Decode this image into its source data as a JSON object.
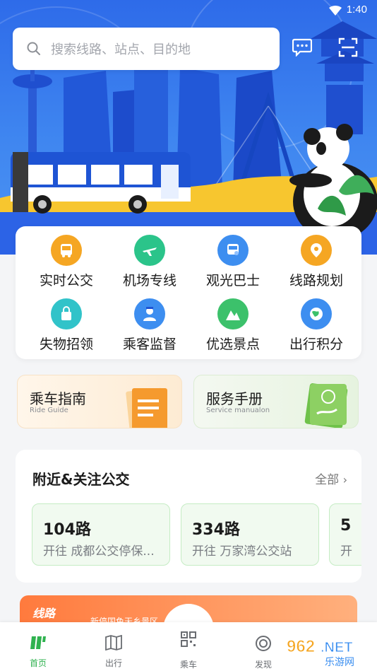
{
  "status_bar": {
    "time": "1:40"
  },
  "search": {
    "placeholder": "搜索线路、站点、目的地"
  },
  "services": [
    {
      "label": "实时公交",
      "icon": "realtime-bus-icon",
      "color": "#f5a623"
    },
    {
      "label": "机场专线",
      "icon": "airport-line-icon",
      "color": "#2bc48a"
    },
    {
      "label": "观光巴士",
      "icon": "sightseeing-bus-icon",
      "color": "#3d8ef0"
    },
    {
      "label": "线路规划",
      "icon": "route-planning-icon",
      "color": "#f5a623"
    },
    {
      "label": "失物招领",
      "icon": "lost-found-icon",
      "color": "#31c3c9"
    },
    {
      "label": "乘客监督",
      "icon": "passenger-supervision-icon",
      "color": "#3d8ef0"
    },
    {
      "label": "优选景点",
      "icon": "scenic-spots-icon",
      "color": "#3cc16b"
    },
    {
      "label": "出行积分",
      "icon": "travel-points-icon",
      "color": "#3d8ef0"
    }
  ],
  "guides": [
    {
      "title": "乘车指南",
      "subtitle": "Ride Guide"
    },
    {
      "title": "服务手册",
      "subtitle": "Service manualon"
    }
  ],
  "nearby": {
    "title": "附近&关注公交",
    "all_label": "全部",
    "routes": [
      {
        "number": "104路",
        "dest": "开往 成都公交停保..."
      },
      {
        "number": "334路",
        "dest": "开往 万家湾公交站"
      },
      {
        "number": "5",
        "dest": "开"
      }
    ]
  },
  "promo": {
    "tag": "线路",
    "text": "新停国色天乡景区"
  },
  "tabs": [
    {
      "label": "首页",
      "icon": "home-icon"
    },
    {
      "label": "出行",
      "icon": "map-icon"
    },
    {
      "label": "乘车",
      "icon": "qr-code-icon"
    },
    {
      "label": "发现",
      "icon": "discover-icon"
    }
  ],
  "watermark": {
    "text": "962.NET",
    "sub": "乐游网"
  },
  "colors": {
    "brand_blue": "#2e6be9",
    "active_green": "#2fb24f"
  }
}
